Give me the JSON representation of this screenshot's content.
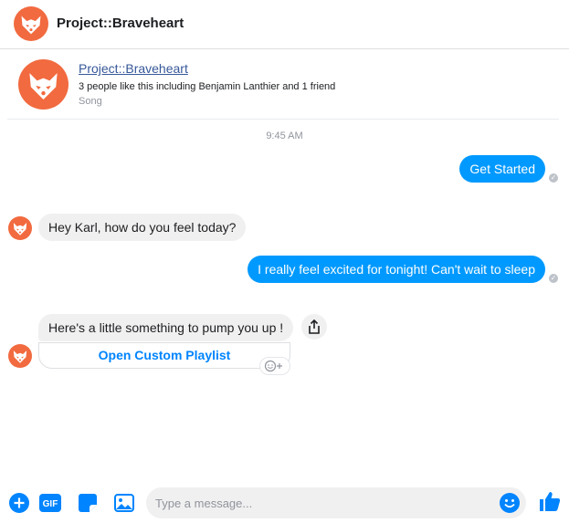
{
  "header": {
    "title": "Project::Braveheart"
  },
  "page_card": {
    "name": "Project::Braveheart",
    "likes": "3 people like this including Benjamin Lanthier and 1 friend",
    "category": "Song"
  },
  "conversation": {
    "timestamp": "9:45 AM",
    "messages": [
      {
        "from": "user",
        "text": "Get Started"
      },
      {
        "from": "page",
        "text": "Hey Karl, how do you feel today?"
      },
      {
        "from": "user",
        "text": "I really feel excited for tonight! Can't wait to sleep"
      },
      {
        "from": "page",
        "text": "Here's a little something to pump you up !"
      }
    ],
    "button_label": "Open Custom Playlist"
  },
  "composer": {
    "placeholder": "Type a message...",
    "gif_label": "GIF"
  },
  "colors": {
    "accent": "#0099ff",
    "brand_avatar": "#f26a3f",
    "incoming_bubble": "#f1f0f0",
    "link": "#365899"
  },
  "icons": [
    "fox-avatar-icon",
    "add-icon",
    "gif-icon",
    "sticker-icon",
    "image-icon",
    "emoji-icon",
    "thumbs-up-icon",
    "share-icon",
    "add-reaction-icon",
    "seen-check-icon"
  ]
}
